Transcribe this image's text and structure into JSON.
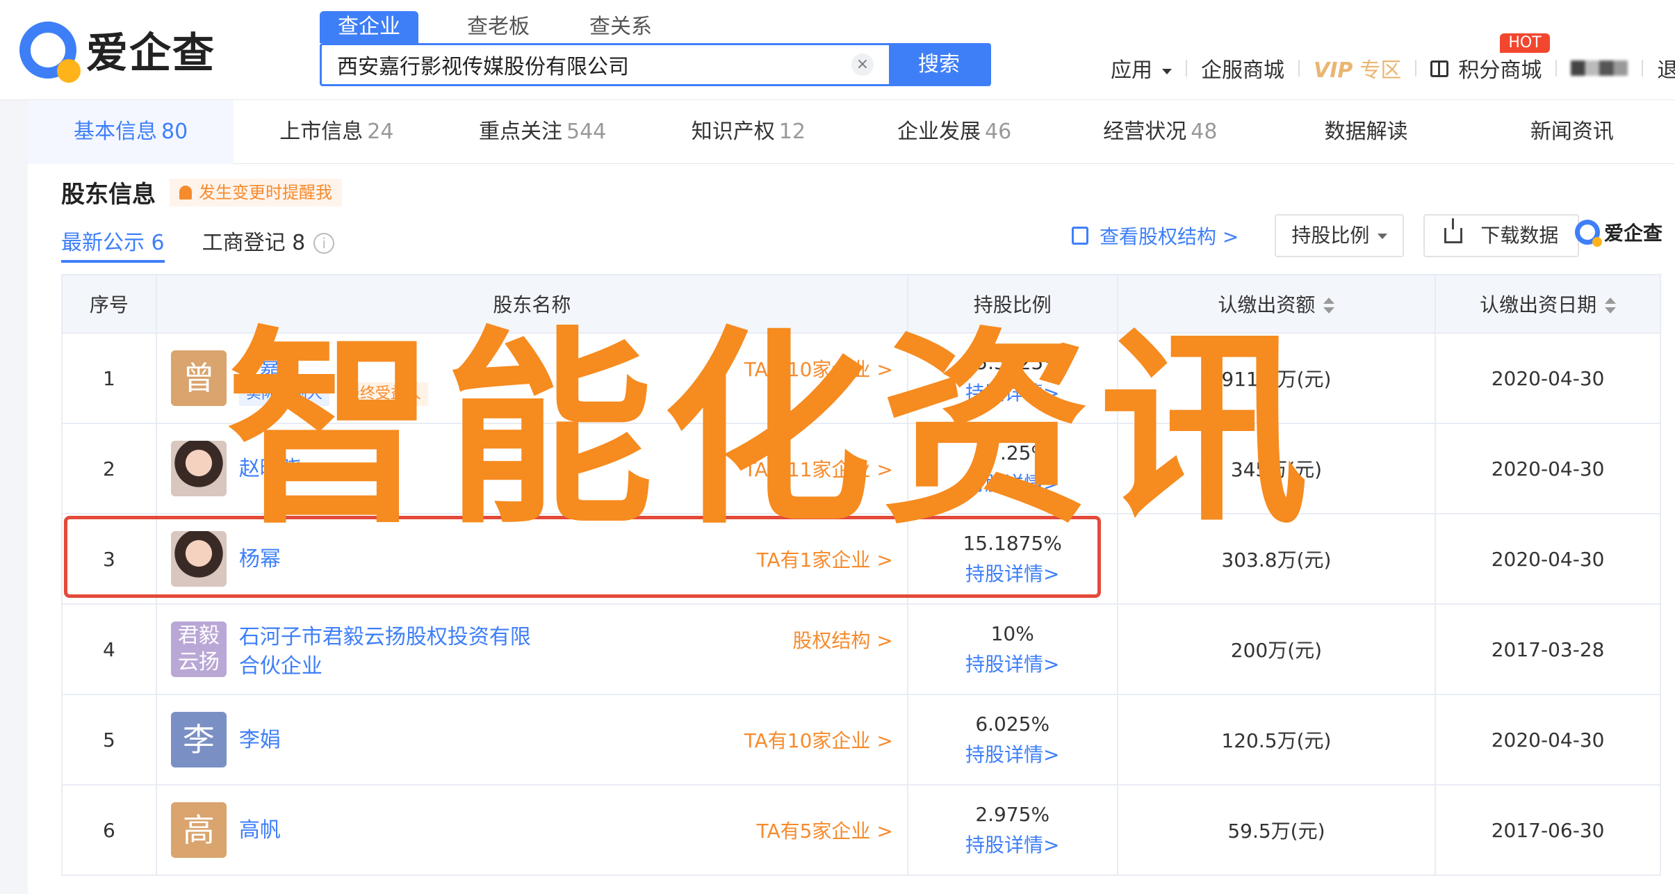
{
  "brand": {
    "name": "爱企查"
  },
  "search": {
    "tabs": [
      "查企业",
      "查老板",
      "查关系"
    ],
    "query": "西安嘉行影视传媒股份有限公司",
    "clear_symbol": "×",
    "button": "搜索"
  },
  "topnav": {
    "apps": "应用",
    "mall": "企服商城",
    "vip": "VIP",
    "vip_area": "专区",
    "points": "积分商城",
    "hot": "HOT",
    "logout": "退出"
  },
  "section_tabs": [
    {
      "label": "基本信息",
      "count": "80"
    },
    {
      "label": "上市信息",
      "count": "24"
    },
    {
      "label": "重点关注",
      "count": "544"
    },
    {
      "label": "知识产权",
      "count": "12"
    },
    {
      "label": "企业发展",
      "count": "46"
    },
    {
      "label": "经营状况",
      "count": "48"
    },
    {
      "label": "数据解读",
      "count": ""
    },
    {
      "label": "新闻资讯",
      "count": ""
    }
  ],
  "shareholders": {
    "title": "股东信息",
    "remind": "发生变更时提醒我",
    "sub_tabs": [
      "最新公示 6",
      "工商登记 8"
    ],
    "info_symbol": "i",
    "view_structure": "查看股权结构 >",
    "sort_dropdown": "持股比例",
    "download": "下载数据",
    "mini_logo": "爱企查",
    "columns": [
      "序号",
      "股东名称",
      "持股比例",
      "认缴出资额",
      "认缴出资日期"
    ],
    "detail_link": "持股详情>",
    "rows": [
      {
        "no": "1",
        "avatar": "曾",
        "avatar_color": "#d9a46d",
        "name": "曾嘉",
        "link": "TA有10家企业 >",
        "tags": [
          "实际控制人",
          "最终受益人"
        ],
        "pct": "45.5625%",
        "amount": "911.3万(元)",
        "date": "2020-04-30"
      },
      {
        "no": "2",
        "avatar": "",
        "avatar_color": "",
        "name": "赵晓晓",
        "link": "TA有11家企业 >",
        "tags": [],
        "pct": "17.25%",
        "amount": "345万(元)",
        "date": "2020-04-30"
      },
      {
        "no": "3",
        "avatar": "",
        "avatar_color": "",
        "name": "杨幂",
        "link": "TA有1家企业 >",
        "tags": [],
        "pct": "15.1875%",
        "amount": "303.8万(元)",
        "date": "2020-04-30"
      },
      {
        "no": "4",
        "avatar": "君毅云扬",
        "avatar_color": "#b9a7d6",
        "name": "石河子市君毅云扬股权投资有限合伙企业",
        "link": "股权结构 >",
        "tags": [],
        "pct": "10%",
        "amount": "200万(元)",
        "date": "2017-03-28"
      },
      {
        "no": "5",
        "avatar": "李",
        "avatar_color": "#7a8fc4",
        "name": "李娟",
        "link": "TA有10家企业 >",
        "tags": [],
        "pct": "6.025%",
        "amount": "120.5万(元)",
        "date": "2020-04-30"
      },
      {
        "no": "6",
        "avatar": "高",
        "avatar_color": "#d9a46d",
        "name": "高帆",
        "link": "TA有5家企业 >",
        "tags": [],
        "pct": "2.975%",
        "amount": "59.5万(元)",
        "date": "2017-06-30"
      }
    ]
  },
  "watermark": "智能化资讯",
  "colors": {
    "accent": "#3e7ff8",
    "orange": "#f68b2d",
    "highlight": "#e34a3a",
    "watermark": "#f68b1f"
  }
}
